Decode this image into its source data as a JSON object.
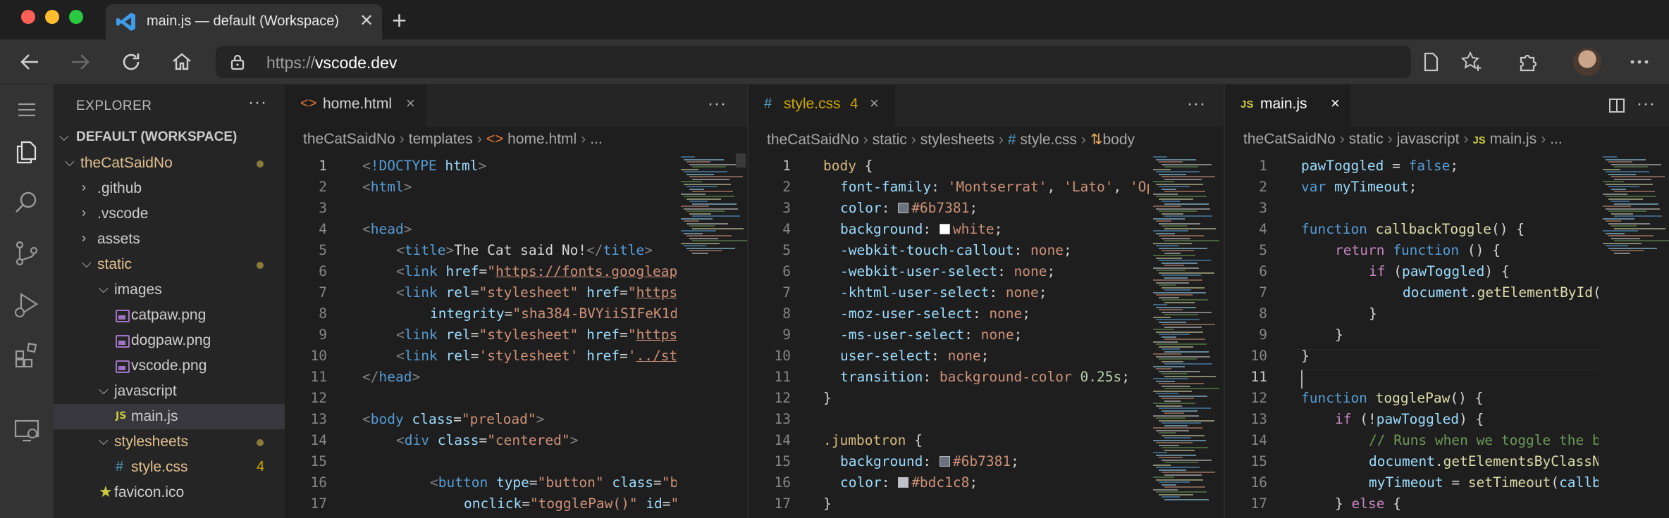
{
  "browser": {
    "tab_title": "main.js — default (Workspace)",
    "url_scheme": "https://",
    "url_host": "vscode.dev"
  },
  "explorer": {
    "title": "EXPLORER",
    "more": "···",
    "workspace": "DEFAULT (WORKSPACE)",
    "tree": [
      {
        "label": "theCatSaidNo",
        "kind": "folder-open",
        "modified": true
      },
      {
        "label": ".github",
        "kind": "folder"
      },
      {
        "label": ".vscode",
        "kind": "folder"
      },
      {
        "label": "assets",
        "kind": "folder"
      },
      {
        "label": "static",
        "kind": "folder-open",
        "modified": true
      },
      {
        "label": "images",
        "kind": "folder-open"
      },
      {
        "label": "catpaw.png",
        "kind": "image"
      },
      {
        "label": "dogpaw.png",
        "kind": "image"
      },
      {
        "label": "vscode.png",
        "kind": "image"
      },
      {
        "label": "javascript",
        "kind": "folder-open"
      },
      {
        "label": "main.js",
        "kind": "js",
        "selected": true
      },
      {
        "label": "stylesheets",
        "kind": "folder-open",
        "modified": true
      },
      {
        "label": "style.css",
        "kind": "css",
        "badge": "4"
      },
      {
        "label": "favicon.ico",
        "kind": "star"
      }
    ]
  },
  "groups": {
    "left": {
      "tab_icon": "<>",
      "tab": "home.html",
      "close": "×",
      "more": "···",
      "crumbs": [
        "theCatSaidNo",
        "templates",
        "home.html",
        "..."
      ]
    },
    "middle": {
      "tab_icon": "#",
      "tab": "style.css",
      "tab_badge": "4",
      "close": "×",
      "more": "···",
      "crumbs": [
        "theCatSaidNo",
        "static",
        "stylesheets",
        "style.css",
        "body"
      ]
    },
    "right": {
      "tab_icon": "JS",
      "tab": "main.js",
      "close": "×",
      "more": "···",
      "crumbs": [
        "theCatSaidNo",
        "static",
        "javascript",
        "main.js",
        "..."
      ]
    }
  },
  "theme": {
    "accent_yellow": "#cbcb41",
    "modified_color": "#e2c08d",
    "editor_bg": "#1e1e1e"
  }
}
